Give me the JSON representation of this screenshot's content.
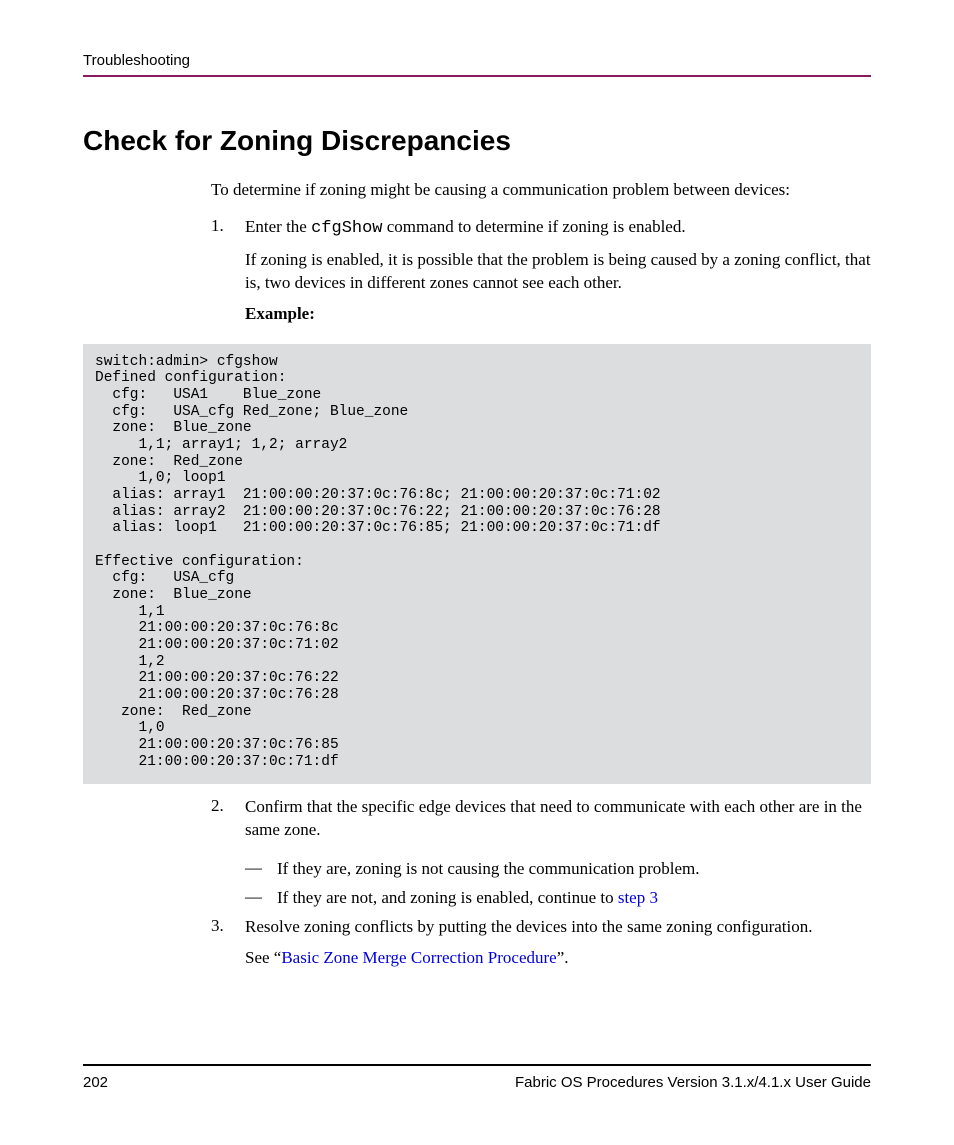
{
  "header": "Troubleshooting",
  "title": "Check for Zoning Discrepancies",
  "intro": "To determine if zoning might be causing a communication problem between devices:",
  "step1": {
    "num": "1.",
    "text_before": "Enter the ",
    "command": "cfgShow",
    "text_after": " command to determine if zoning is enabled.",
    "followup": "If zoning is enabled, it is possible that the problem is being caused by a zoning conflict, that is, two devices in different zones cannot see each other."
  },
  "example_label": "Example:",
  "code": "switch:admin> cfgshow\nDefined configuration:\n  cfg:   USA1    Blue_zone\n  cfg:   USA_cfg Red_zone; Blue_zone\n  zone:  Blue_zone\n     1,1; array1; 1,2; array2\n  zone:  Red_zone\n     1,0; loop1\n  alias: array1  21:00:00:20:37:0c:76:8c; 21:00:00:20:37:0c:71:02\n  alias: array2  21:00:00:20:37:0c:76:22; 21:00:00:20:37:0c:76:28\n  alias: loop1   21:00:00:20:37:0c:76:85; 21:00:00:20:37:0c:71:df\n\nEffective configuration:\n  cfg:   USA_cfg\n  zone:  Blue_zone\n     1,1\n     21:00:00:20:37:0c:76:8c\n     21:00:00:20:37:0c:71:02\n     1,2\n     21:00:00:20:37:0c:76:22\n     21:00:00:20:37:0c:76:28\n   zone:  Red_zone\n     1,0\n     21:00:00:20:37:0c:76:85\n     21:00:00:20:37:0c:71:df",
  "step2": {
    "num": "2.",
    "text": "Confirm that the specific edge devices that need to communicate with each other are in the same zone.",
    "dash1": "If they are, zoning is not causing the communication problem.",
    "dash2_before": "If they are not, and zoning is enabled, continue to ",
    "dash2_link": "step 3"
  },
  "step3": {
    "num": "3.",
    "text": "Resolve zoning conflicts by putting the devices into the same zoning configuration.",
    "see_before": "See “",
    "see_link": "Basic Zone Merge Correction Procedure",
    "see_after": "”."
  },
  "footer": {
    "page": "202",
    "right": "Fabric OS Procedures Version 3.1.x/4.1.x User Guide"
  },
  "dash_char": "—"
}
